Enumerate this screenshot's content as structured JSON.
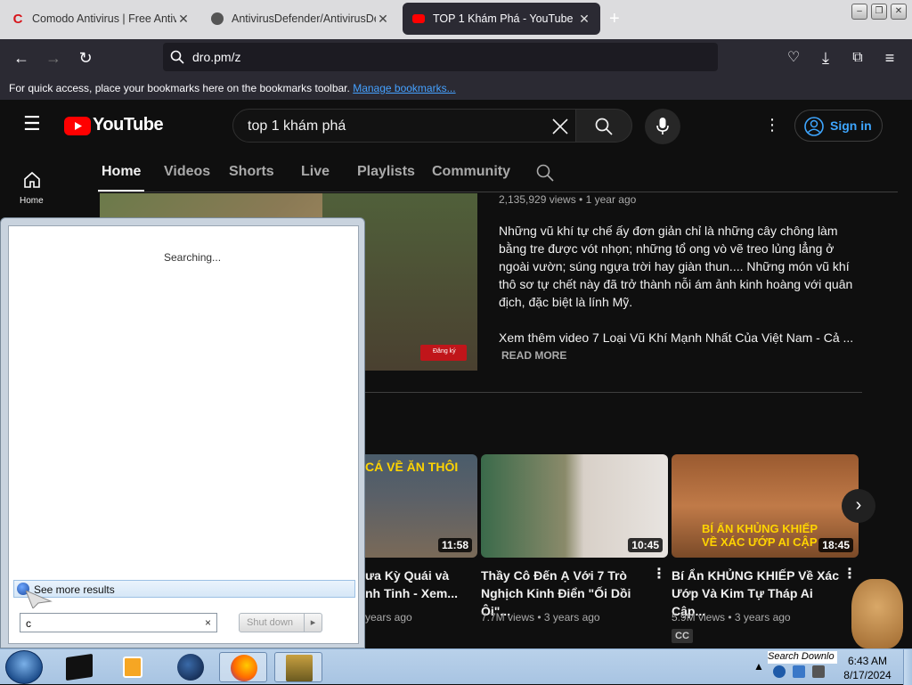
{
  "tabs": [
    {
      "title": "Comodo Antivirus | Free Antivir",
      "favicon": "comodo-icon"
    },
    {
      "title": "AntivirusDefender/AntivirusDef",
      "favicon": "github-icon"
    },
    {
      "title": "TOP 1 Khám Phá - YouTube",
      "favicon": "youtube-icon"
    }
  ],
  "new_tab": "+",
  "url": "dro.pm/z",
  "bookmarks_bar": {
    "text": "For quick access, place your bookmarks here on the bookmarks toolbar.",
    "link": "Manage bookmarks..."
  },
  "youtube": {
    "logo_text": "YouTube",
    "search_query": "top 1 khám phá",
    "sign_in": "Sign in",
    "sidebar_home": "Home",
    "channel_tabs": [
      "Home",
      "Videos",
      "Shorts",
      "Live",
      "Playlists",
      "Community"
    ],
    "featured": {
      "meta": "2,135,929 views • 1 year ago",
      "description": [
        "Những vũ khí tự chế ấy đơn giản chỉ là những cây chông làm",
        "bằng tre được vót nhọn; những tổ ong vò vẽ treo lủng lẳng ở",
        "ngoài vườn; súng ngựa trời hay giàn thun.... Những món vũ khí",
        "thô sơ tự chết này đã trở thành nỗi ám ảnh kinh hoàng với quân",
        "địch, đặc biệt là lính Mỹ."
      ],
      "more_line": "Xem thêm video 7 Loại Vũ Khí Mạnh Nhất Của Việt Nam - Cả ...",
      "read_more": "READ MORE",
      "subscribe_badge": "Đăng ký"
    },
    "videos": [
      {
        "thumb_text": "CÁ VỀ ĂN THÔI",
        "duration": "11:58",
        "title_l1": "ưa Kỳ Quái và",
        "title_l2": "nh Tinh - Xem...",
        "meta": "years ago"
      },
      {
        "thumb_text": "",
        "duration": "10:45",
        "title_l1": "Thầy Cô Đến Ạ Với 7 Trò",
        "title_l2": "Nghịch Kinh Điển \"Ối Dồi Ôi\"...",
        "meta": "7.7M views • 3 years ago"
      },
      {
        "thumb_text": "BÍ ẨN KHỦNG KHIẾP VỀ XÁC ƯỚP AI CẬP",
        "duration": "18:45",
        "title_l1": "Bí Ẩn KHỦNG KHIẾP Về Xác",
        "title_l2": "Ướp Và Kim Tự Tháp Ai Cập...",
        "meta": "5.9M views • 3 years ago",
        "badge": "CC"
      }
    ]
  },
  "search_popup": {
    "status": "Searching...",
    "see_more": "See more results",
    "query": "c",
    "clear": "×",
    "shutdown": "Shut down"
  },
  "taskbar": {
    "search_downloads": "Search Downlo",
    "time": "6:43 AM",
    "date": "8/17/2024"
  }
}
